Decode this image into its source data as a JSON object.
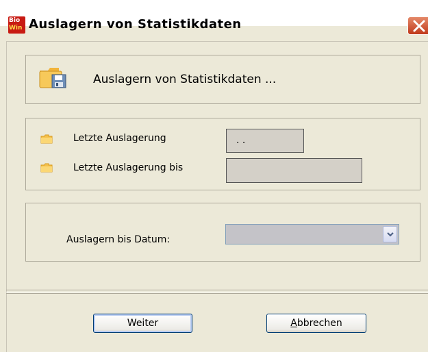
{
  "window": {
    "title": "Auslagern von Statistikdaten",
    "app_icon_line1": "Bio",
    "app_icon_line2": "Win"
  },
  "header": {
    "text": "Auslagern von Statistikdaten ..."
  },
  "info": {
    "last_export_label": "Letzte Auslagerung",
    "last_export_value": ". .",
    "last_export_until_label": "Letzte Auslagerung bis",
    "last_export_until_value": ""
  },
  "export": {
    "date_label": "Auslagern bis Datum:",
    "date_value": ""
  },
  "buttons": {
    "next_label": "Weiter",
    "cancel_label_accel": "A",
    "cancel_label_rest": "bbrechen"
  }
}
